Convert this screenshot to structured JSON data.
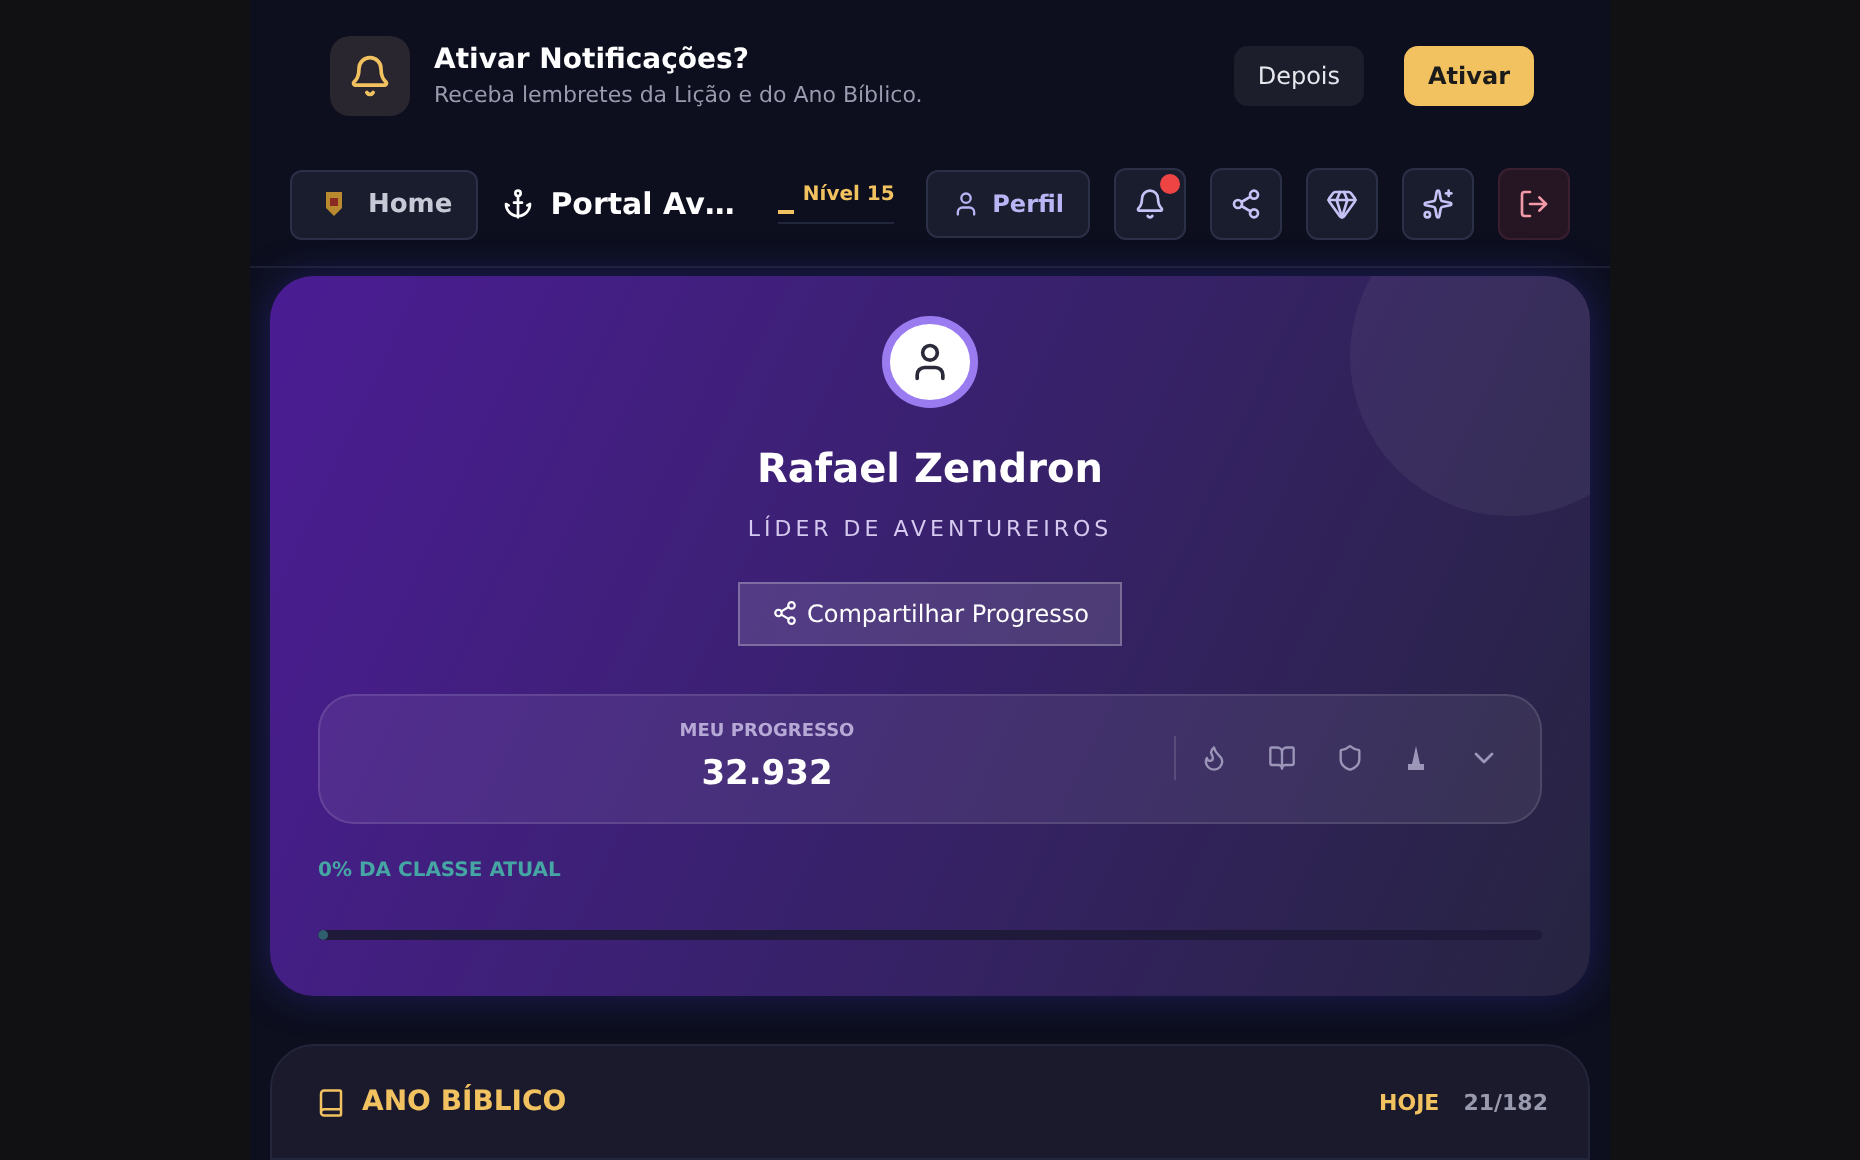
{
  "notification_banner": {
    "title": "Ativar Notificações?",
    "message": "Receba lembretes da Lição e do Ano Bíblico.",
    "buttons": [
      {
        "label": "Depois",
        "kind": "secondary"
      },
      {
        "label": "Ativar",
        "kind": "primary"
      }
    ]
  },
  "header": {
    "home_label": "Home",
    "portal_title": "Portal Av…",
    "level_label": "Nível 15",
    "profile_label": "Perfil",
    "notifications_unread": true
  },
  "profile": {
    "name": "Rafael Zendron",
    "role": "LÍDER DE AVENTUREIROS",
    "share_label": "Compartilhar Progresso",
    "progress": {
      "label": "MEU PROGRESSO",
      "points": "32.932",
      "expanded": false
    },
    "class_progress": {
      "label": "0% DA CLASSE ATUAL",
      "level": 0
    }
  },
  "bible_year": {
    "title": "ANO BÍBLICO",
    "today_label": "HOJE",
    "count": "21/182"
  }
}
